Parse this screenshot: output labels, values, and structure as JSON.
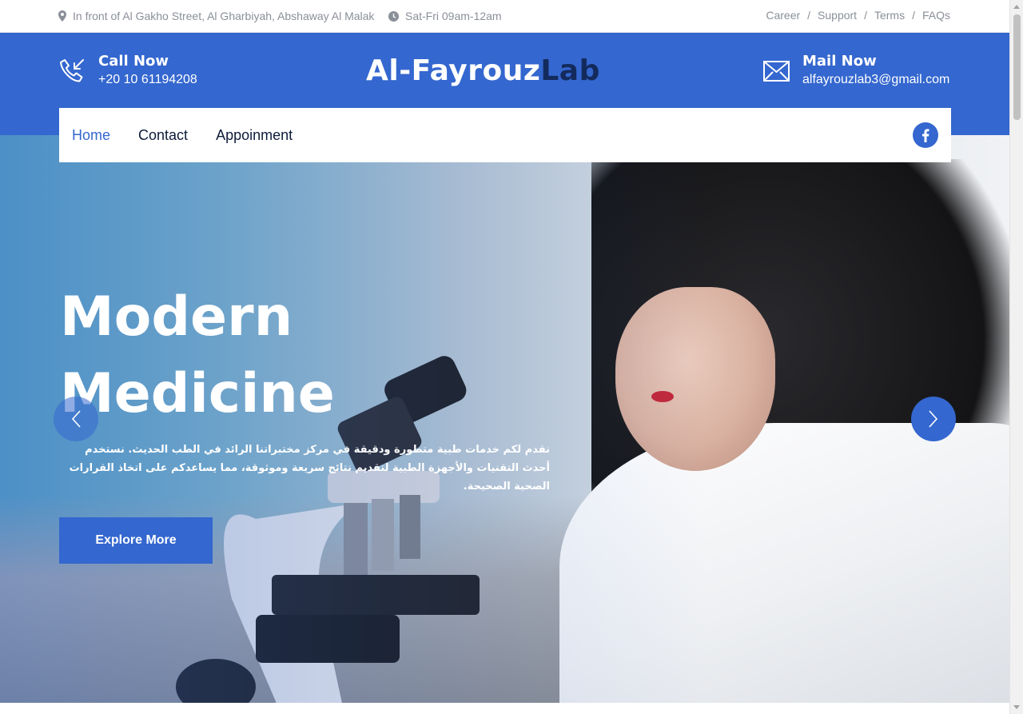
{
  "topbar": {
    "address": "In front of Al Gakho Street, Al Gharbiyah, Abshaway Al Malak",
    "hours": "Sat-Fri 09am-12am",
    "links": [
      "Career",
      "Support",
      "Terms",
      "FAQs"
    ],
    "separator": "/"
  },
  "header": {
    "call_label": "Call Now",
    "call_value": "+20 10 61194208",
    "logo_part1": "Al-Fayrouz",
    "logo_part2": "Lab",
    "mail_label": "Mail Now",
    "mail_value": "alfayrouzlab3@gmail.com"
  },
  "nav": {
    "items": [
      "Home",
      "Contact",
      "Appoinment"
    ],
    "active": "Home",
    "social_icon": "facebook-icon"
  },
  "hero": {
    "title_line1": "Modern",
    "title_line2": "Medicine",
    "description": "نقدم لكم خدمات طبية متطورة ودقيقة في مركز مختبراتنا الرائد في الطب الحديث. نستخدم أحدث التقنيات والأجهزة الطبية لتقديم نتائج سريعة وموثوقة، مما يساعدكم على اتخاذ القرارات الصحية الصحيحة.",
    "button_label": "Explore More",
    "prev_icon": "chevron-left-icon",
    "next_icon": "chevron-right-icon"
  },
  "colors": {
    "primary": "#3467cf",
    "dark": "#132a5c",
    "muted": "#8a8f98"
  }
}
